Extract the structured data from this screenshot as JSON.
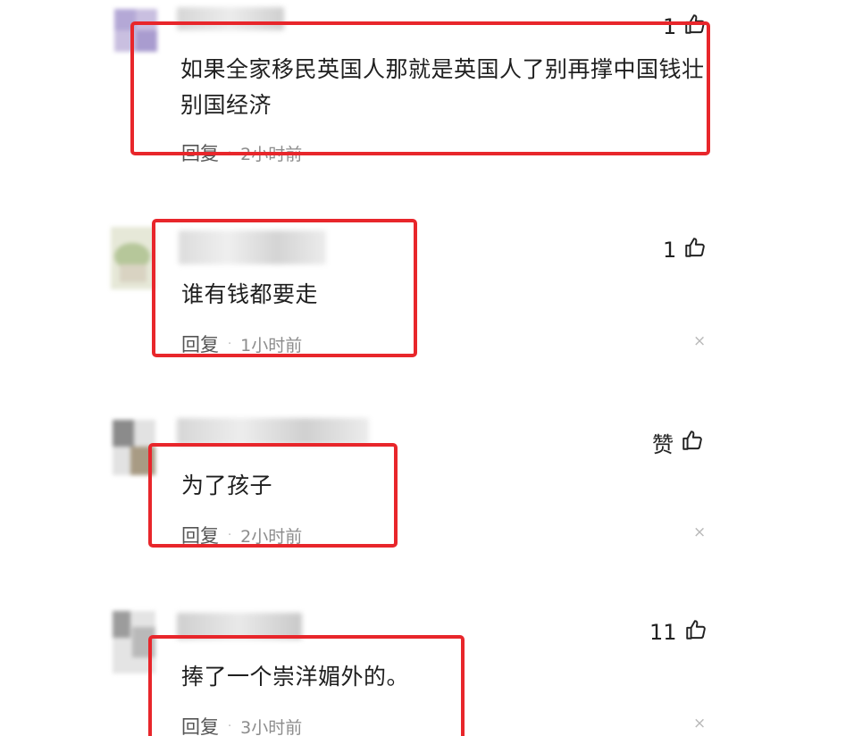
{
  "comments": [
    {
      "text": "如果全家移民英国人那就是英国人了别再撑中国钱壮\n别国经济",
      "reply_label": "回复",
      "separator": "·",
      "time": "2小时前",
      "likes": "1",
      "like_icon": "thumbs-up-icon"
    },
    {
      "text": "谁有钱都要走",
      "reply_label": "回复",
      "separator": "·",
      "time": "1小时前",
      "likes": "1",
      "like_icon": "thumbs-up-icon",
      "close": "×"
    },
    {
      "text": "为了孩子",
      "reply_label": "回复",
      "separator": "·",
      "time": "2小时前",
      "likes": "赞",
      "like_icon": "thumbs-up-icon",
      "close": "×"
    },
    {
      "text": "捧了一个崇洋媚外的。",
      "reply_label": "回复",
      "separator": "·",
      "time": "3小时前",
      "likes": "11",
      "like_icon": "thumbs-up-icon",
      "close": "×"
    }
  ],
  "colors": {
    "highlight_border": "#e8262b",
    "text": "#1f1f1f",
    "meta": "#8c8c8c"
  }
}
